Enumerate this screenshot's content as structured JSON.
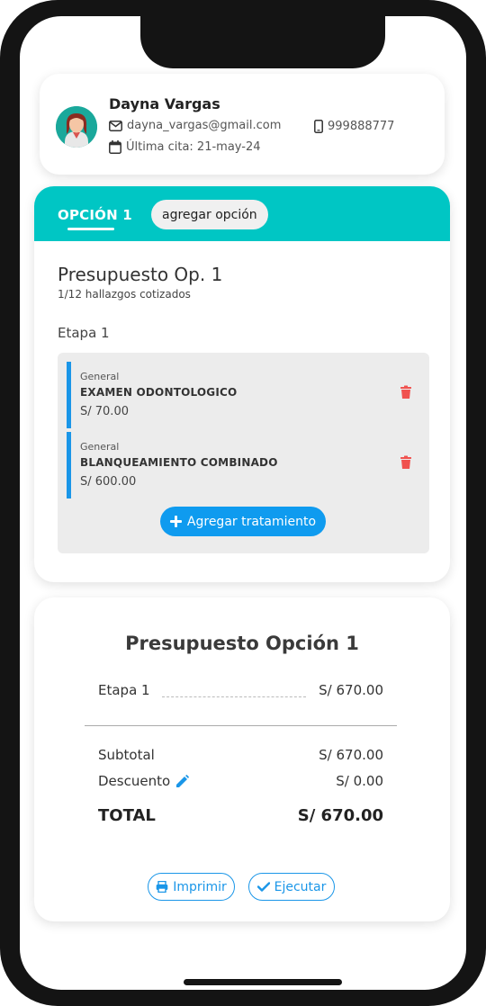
{
  "colors": {
    "accent": "#00c6c4",
    "primary_blue": "#0f9bef",
    "danger": "#f0524f"
  },
  "patient": {
    "name": "Dayna Vargas",
    "email": "dayna_vargas@gmail.com",
    "phone": "999888777",
    "last_visit": "Última cita: 21-may-24",
    "icons": {
      "email": "envelope-icon",
      "phone": "mobile-phone-icon",
      "calendar": "calendar-icon"
    }
  },
  "tabs": {
    "active_label": "OPCIÓN 1",
    "add_option_label": "agregar opción"
  },
  "budget": {
    "title": "Presupuesto Op. 1",
    "subtitle": "1/12 hallazgos cotizados",
    "stage_label": "Etapa 1",
    "treatments": [
      {
        "category": "General",
        "name": "EXAMEN ODONTOLOGICO",
        "price": "S/ 70.00"
      },
      {
        "category": "General",
        "name": "BLANQUEAMIENTO COMBINADO",
        "price": "S/ 600.00"
      }
    ],
    "add_treatment_label": "Agregar tratamiento"
  },
  "summary": {
    "title": "Presupuesto Opción 1",
    "stage_label": "Etapa 1",
    "stage_amount": "S/ 670.00",
    "subtotal_label": "Subtotal",
    "subtotal_value": "S/ 670.00",
    "discount_label": "Descuento",
    "discount_value": "S/ 0.00",
    "total_label": "TOTAL",
    "total_value": "S/ 670.00"
  },
  "actions": {
    "print_label": "Imprimir",
    "execute_label": "Ejecutar"
  }
}
